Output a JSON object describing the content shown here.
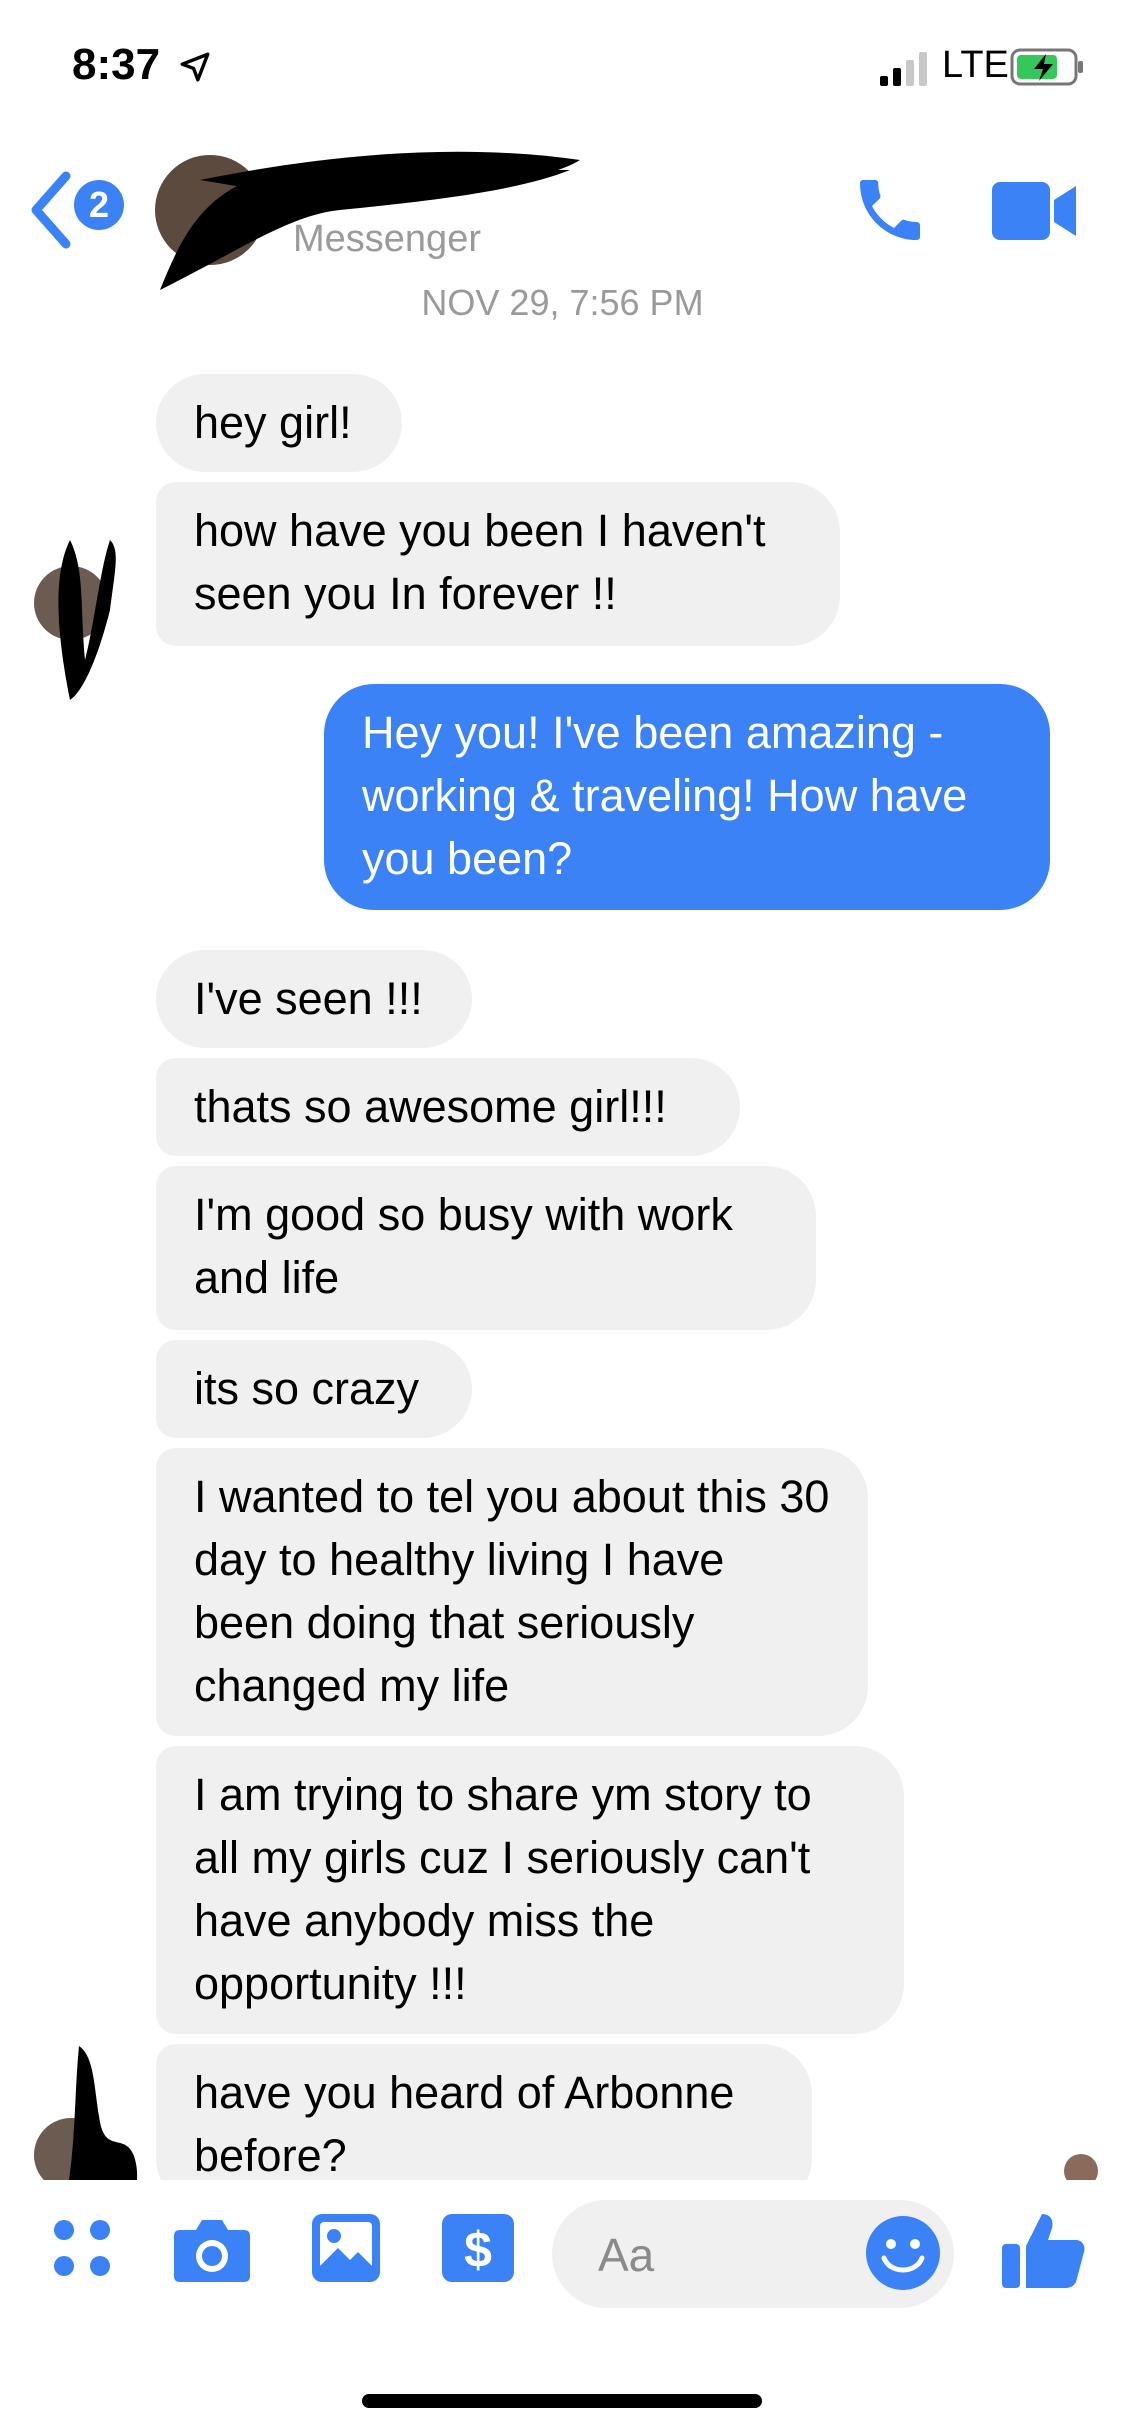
{
  "status": {
    "time": "8:37",
    "network": "LTE"
  },
  "header": {
    "back_badge": "2",
    "subtitle": "Messenger"
  },
  "timestamp": "NOV 29, 7:56 PM",
  "messages": [
    {
      "text": "hey girl!"
    },
    {
      "text": "how have you been I haven't seen you In forever !!"
    },
    {
      "text": "Hey you! I've been amazing - working & traveling! How have you been?"
    },
    {
      "text": "I've seen !!!"
    },
    {
      "text": "thats so awesome girl!!!"
    },
    {
      "text": "I'm good so busy with work and life"
    },
    {
      "text": "its so crazy"
    },
    {
      "text": "I wanted to tel you about this 30 day to healthy living I have been doing that seriously changed my life"
    },
    {
      "text": "I am trying to share ym story to all my girls cuz I seriously can't have anybody miss the opportunity !!!"
    },
    {
      "text": "have you heard of Arbonne before?"
    }
  ],
  "composer": {
    "placeholder": "Aa"
  },
  "colors": {
    "accent": "#3b82f6",
    "incoming_bubble": "#f0f0f0",
    "meta_text": "#9a9a9a"
  },
  "icons": [
    "back-chevron-icon",
    "phone-icon",
    "video-camera-icon",
    "apps-icon",
    "camera-icon",
    "photo-icon",
    "payment-icon",
    "emoji-icon",
    "thumbs-up-icon"
  ]
}
